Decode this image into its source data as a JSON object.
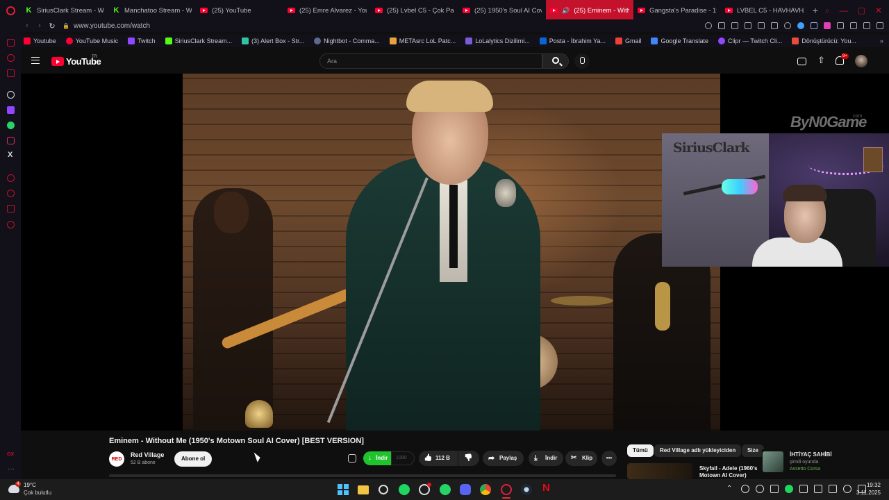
{
  "tabs": [
    {
      "label": "SiriusClark Stream - Wat",
      "icon": "kick-icon"
    },
    {
      "label": "Manchatoo Stream - Wa",
      "icon": "kick-icon"
    },
    {
      "label": "(25) YouTube",
      "icon": "youtube-icon"
    },
    {
      "label": "(25) Emre Alvarez - Yout",
      "icon": "youtube-icon"
    },
    {
      "label": "(25) Lvbel C5 - Çok Pard",
      "icon": "youtube-icon"
    },
    {
      "label": "(25) 1950's Soul AI Cove",
      "icon": "youtube-icon"
    },
    {
      "label": "(25) Eminem - Withou",
      "icon": "youtube-icon",
      "active": true
    },
    {
      "label": "Gangsta's Paradise - 195",
      "icon": "youtube-icon"
    },
    {
      "label": "LVBEL C5 - HAVHAVHAV",
      "icon": "youtube-icon"
    }
  ],
  "address": {
    "url": "www.youtube.com/watch"
  },
  "bookmarks": [
    {
      "label": "Youtube",
      "icon": "youtube-icon",
      "color": "#ff0033"
    },
    {
      "label": "YouTube Music",
      "icon": "youtube-music-icon",
      "color": "#ff0033"
    },
    {
      "label": "Twitch",
      "icon": "twitch-icon",
      "color": "#9146ff"
    },
    {
      "label": "SiriusClark Stream...",
      "icon": "kick-icon",
      "color": "#53fc18"
    },
    {
      "label": "(3) Alert Box - Str...",
      "icon": "streamlabs-icon",
      "color": "#31c3a2"
    },
    {
      "label": "Nightbot - Comma...",
      "icon": "nightbot-icon",
      "color": "#5b6b8c"
    },
    {
      "label": "METAsrc LoL Patc...",
      "icon": "metasrc-icon",
      "color": "#e8a33d"
    },
    {
      "label": "LoLalytics Dizilimi...",
      "icon": "lolalytics-icon",
      "color": "#7b5cd6"
    },
    {
      "label": "Posta - İbrahim Ya...",
      "icon": "outlook-icon",
      "color": "#0a64d6"
    },
    {
      "label": "Gmail",
      "icon": "gmail-icon",
      "color": "#ea4335"
    },
    {
      "label": "Google Translate",
      "icon": "translate-icon",
      "color": "#4285f4"
    },
    {
      "label": "Clipr — Twitch Cli...",
      "icon": "clipr-icon",
      "color": "#9146ff"
    },
    {
      "label": "Dönüştürücü: You...",
      "icon": "converter-icon",
      "color": "#e74c3c"
    }
  ],
  "youtube": {
    "logo": "YouTube",
    "country": "TR",
    "search_placeholder": "Ara",
    "notification_count": "9+"
  },
  "video": {
    "title": "Eminem - Without Me (1950's Motown Soul AI Cover) [BEST VERSION]",
    "watermark": "ByN0Game",
    "watermark_suffix": "com",
    "webcam_logo": "SiriusClark"
  },
  "channel": {
    "name": "Red Village",
    "subscribers": "52 B abone",
    "avatar_text": "RED",
    "subscribe_label": "Abone ol"
  },
  "actions": {
    "download_label": "İndir",
    "quality": "1080",
    "likes": "112 B",
    "share": "Paylaş",
    "download": "İndir",
    "clip": "Klip",
    "more": "•••"
  },
  "chips": {
    "all": "Tümü",
    "uploader": "Red Village adlı yükleyiciden",
    "for_you": "Size"
  },
  "recommendation": {
    "title": "Skyfall - Adele (1960's Motown AI Cover)"
  },
  "toast": {
    "name": "İHTİYAÇ SAHİBİ",
    "status": "şimdi oyunda",
    "game": "Assetto Corsa"
  },
  "taskbar": {
    "temperature": "19°C",
    "weather": "Çok bulutlu",
    "weather_badge": "4",
    "time": "19:32",
    "date": "3.11.2025"
  },
  "colors": {
    "accent": "#c4112c",
    "youtube_red": "#ff0033",
    "download_green": "#1fc32c"
  }
}
